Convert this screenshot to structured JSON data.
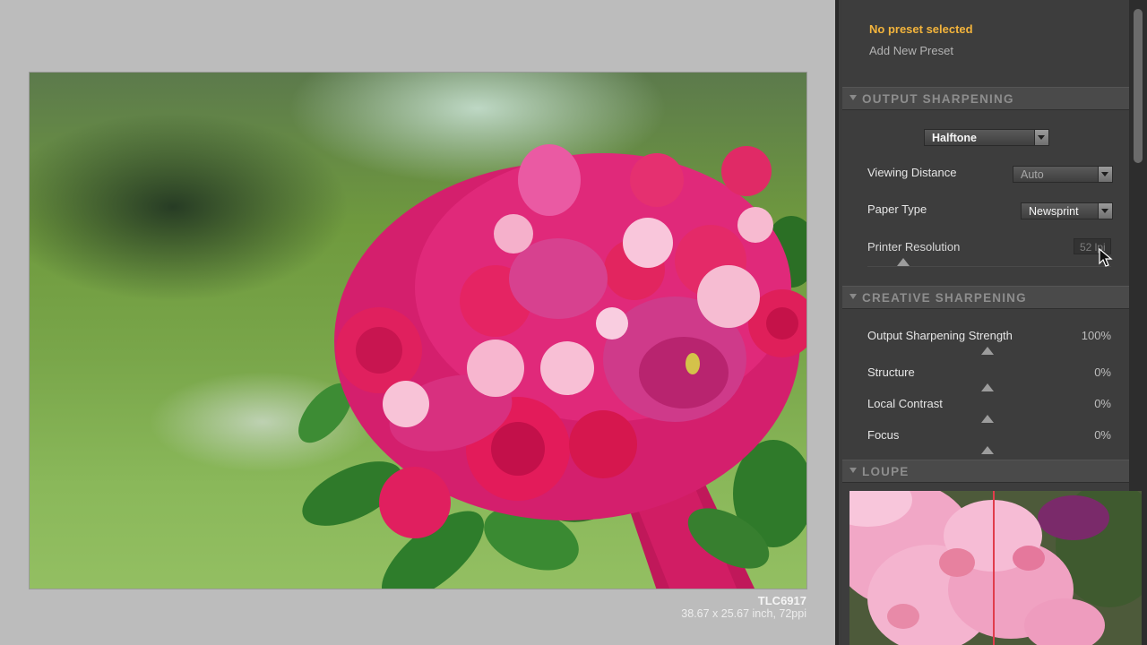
{
  "image": {
    "caption_name": "TLC6917",
    "caption_dims": "38.67 x 25.67 inch, 72ppi"
  },
  "panel": {
    "preset_status": "No preset selected",
    "add_preset": "Add New Preset",
    "output_sharpening": {
      "header": "OUTPUT SHARPENING",
      "mode": "Halftone",
      "viewing_distance_label": "Viewing Distance",
      "viewing_distance_value": "Auto",
      "paper_type_label": "Paper Type",
      "paper_type_value": "Newsprint",
      "printer_resolution_label": "Printer Resolution",
      "printer_resolution_value": "52 lpi"
    },
    "creative_sharpening": {
      "header": "CREATIVE SHARPENING",
      "rows": [
        {
          "label": "Output Sharpening Strength",
          "value": "100%"
        },
        {
          "label": "Structure",
          "value": "0%"
        },
        {
          "label": "Local Contrast",
          "value": "0%"
        },
        {
          "label": "Focus",
          "value": "0%"
        }
      ]
    },
    "loupe": {
      "header": "LOUPE"
    }
  },
  "colors": {
    "accent": "#f3b43c",
    "panel_bg": "#3d3d3d",
    "canvas_bg": "#bcbcbc",
    "loupe_guide": "#e13c4c"
  },
  "icons": [
    "collapse-triangle-icon",
    "dropdown-arrow-icon",
    "slider-thumb-icon",
    "mouse-cursor-icon"
  ]
}
